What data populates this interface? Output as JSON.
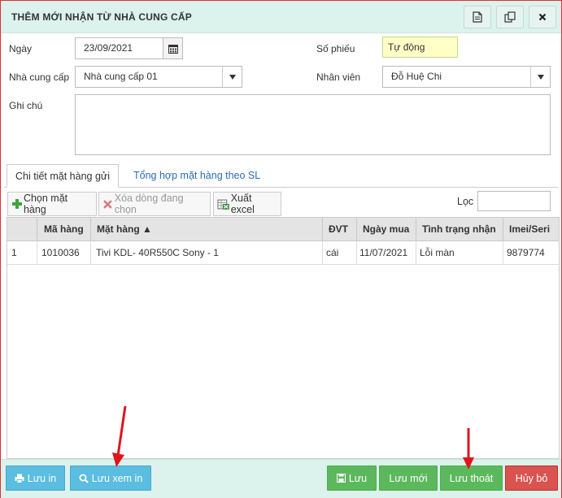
{
  "dialog": {
    "title": "THÊM MỚI NHẬN TỪ NHÀ CUNG CẤP",
    "header_icons": [
      "document-icon",
      "copy-icon",
      "close-icon"
    ]
  },
  "form": {
    "ngay_label": "Ngày",
    "ngay_value": "23/09/2021",
    "so_phieu_label": "Số phiếu",
    "so_phieu_value": "Tự động",
    "nha_cung_cap_label": "Nhà cung cấp",
    "nha_cung_cap_value": "Nhà cung cấp 01",
    "nhan_vien_label": "Nhân viên",
    "nhan_vien_value": "Đỗ Huệ Chi",
    "ghi_chu_label": "Ghi chú",
    "ghi_chu_value": ""
  },
  "tabs": [
    {
      "label": "Chi tiết mặt hàng gửi",
      "active": true
    },
    {
      "label": "Tổng hợp mặt hàng theo SL",
      "active": false
    }
  ],
  "toolbar": {
    "chon_mat_hang": "Chọn mặt hàng",
    "xoa_dong": "Xóa dòng đang chọn",
    "xuat_excel": "Xuất excel",
    "loc_label": "Lọc",
    "loc_value": ""
  },
  "grid": {
    "columns": [
      "",
      "Mã hàng",
      "Mặt hàng ▲",
      "ĐVT",
      "Ngày mua",
      "Tình trạng nhận",
      "Imei/Seri"
    ],
    "rows": [
      [
        "1",
        "1010036",
        "Tivi KDL- 40R550C Sony - 1",
        "cái",
        "11/07/2021",
        "Lỗi màn",
        "9879774"
      ]
    ]
  },
  "footer": {
    "luu_in": "Lưu in",
    "luu_xem_in": "Lưu xem in",
    "luu": "Lưu",
    "luu_moi": "Lưu mới",
    "luu_thoat": "Lưu thoát",
    "huy_bo": "Hủy bỏ"
  },
  "colors": {
    "header_bg": "#dcf2ec",
    "accent_blue": "#5bbde0",
    "accent_green": "#5cb85c",
    "accent_red": "#d9534f",
    "annotation_arrow": "#e0141e"
  }
}
